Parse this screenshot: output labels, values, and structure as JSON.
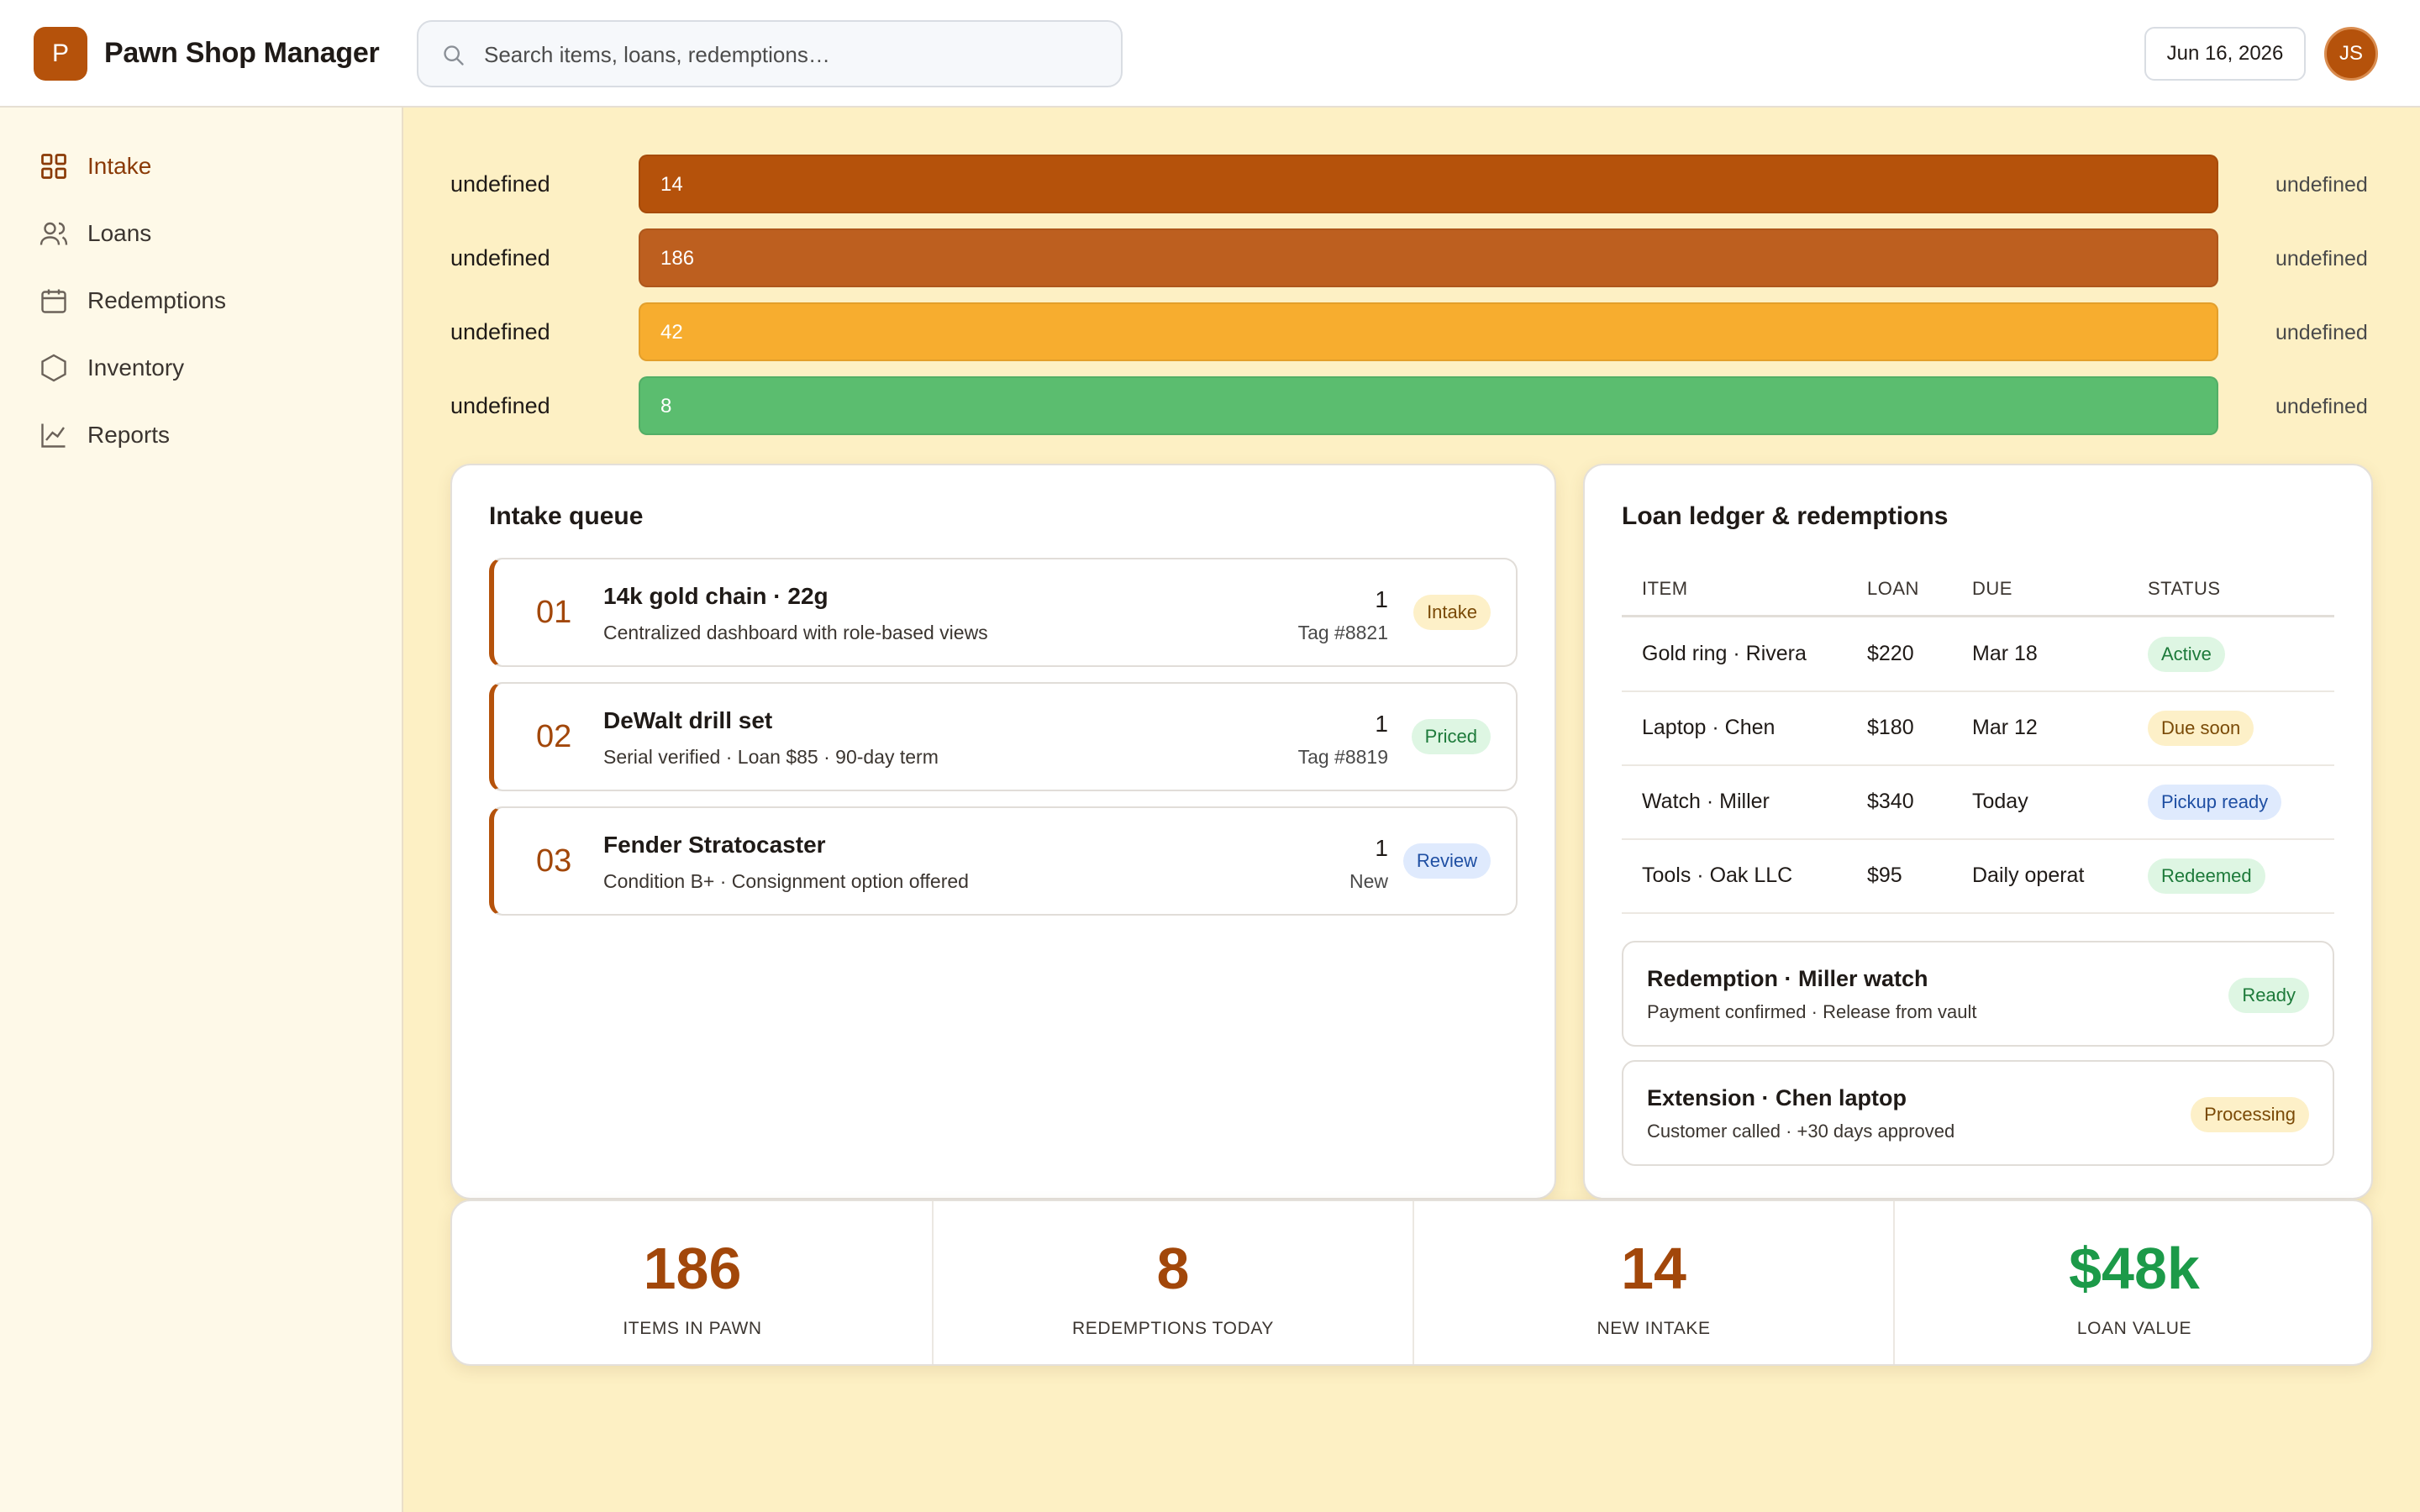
{
  "app": {
    "logo_letter": "P",
    "title": "Pawn Shop Manager"
  },
  "search": {
    "placeholder": "Search items, loans, redemptions…"
  },
  "header": {
    "date": "Jun 16, 2026",
    "avatar_initials": "JS"
  },
  "sidebar": {
    "items": [
      {
        "label": "Intake",
        "icon": "grid-icon",
        "active": true
      },
      {
        "label": "Loans",
        "icon": "users-icon",
        "active": false
      },
      {
        "label": "Redemptions",
        "icon": "calendar-icon",
        "active": false
      },
      {
        "label": "Inventory",
        "icon": "hexagon-icon",
        "active": false
      },
      {
        "label": "Reports",
        "icon": "chart-icon",
        "active": false
      }
    ]
  },
  "bars": [
    {
      "label": "undefined",
      "value": "14",
      "right": "undefined",
      "color": "#b5520b"
    },
    {
      "label": "undefined",
      "value": "186",
      "right": "undefined",
      "color": "#bd5f1f"
    },
    {
      "label": "undefined",
      "value": "42",
      "right": "undefined",
      "color": "#f7ad2f"
    },
    {
      "label": "undefined",
      "value": "8",
      "right": "undefined",
      "color": "#5bbd6f"
    }
  ],
  "intake": {
    "title": "Intake queue",
    "items": [
      {
        "num": "01",
        "title": "14k gold chain · 22g",
        "sub": "Centralized dashboard with role-based views",
        "count": "1",
        "tag": "Tag #8821",
        "status": "Intake"
      },
      {
        "num": "02",
        "title": "DeWalt drill set",
        "sub": "Serial verified · Loan $85 · 90-day term",
        "count": "1",
        "tag": "Tag #8819",
        "status": "Priced"
      },
      {
        "num": "03",
        "title": "Fender Stratocaster",
        "sub": "Condition B+ · Consignment option offered",
        "count": "1",
        "tag": "New",
        "status": "Review"
      }
    ]
  },
  "ledger": {
    "title": "Loan ledger & redemptions",
    "columns": [
      "ITEM",
      "LOAN",
      "DUE",
      "STATUS"
    ],
    "rows": [
      {
        "item": "Gold ring · Rivera",
        "loan": "$220",
        "due": "Mar 18",
        "status": "Active"
      },
      {
        "item": "Laptop · Chen",
        "loan": "$180",
        "due": "Mar 12",
        "status": "Due soon"
      },
      {
        "item": "Watch · Miller",
        "loan": "$340",
        "due": "Today",
        "status": "Pickup ready"
      },
      {
        "item": "Tools · Oak LLC",
        "loan": "$95",
        "due": "Daily operat",
        "status": "Redeemed"
      }
    ],
    "actions": [
      {
        "title": "Redemption · Miller watch",
        "sub": "Payment confirmed · Release from vault",
        "status": "Ready"
      },
      {
        "title": "Extension · Chen laptop",
        "sub": "Customer called · +30 days approved",
        "status": "Processing"
      }
    ]
  },
  "stats": [
    {
      "value": "186",
      "label": "ITEMS IN PAWN",
      "color": "#a2470a"
    },
    {
      "value": "8",
      "label": "REDEMPTIONS TODAY",
      "color": "#a2470a"
    },
    {
      "value": "14",
      "label": "NEW INTAKE",
      "color": "#a2470a"
    },
    {
      "value": "$48k",
      "label": "LOAN VALUE",
      "color": "#1c9a49"
    }
  ]
}
